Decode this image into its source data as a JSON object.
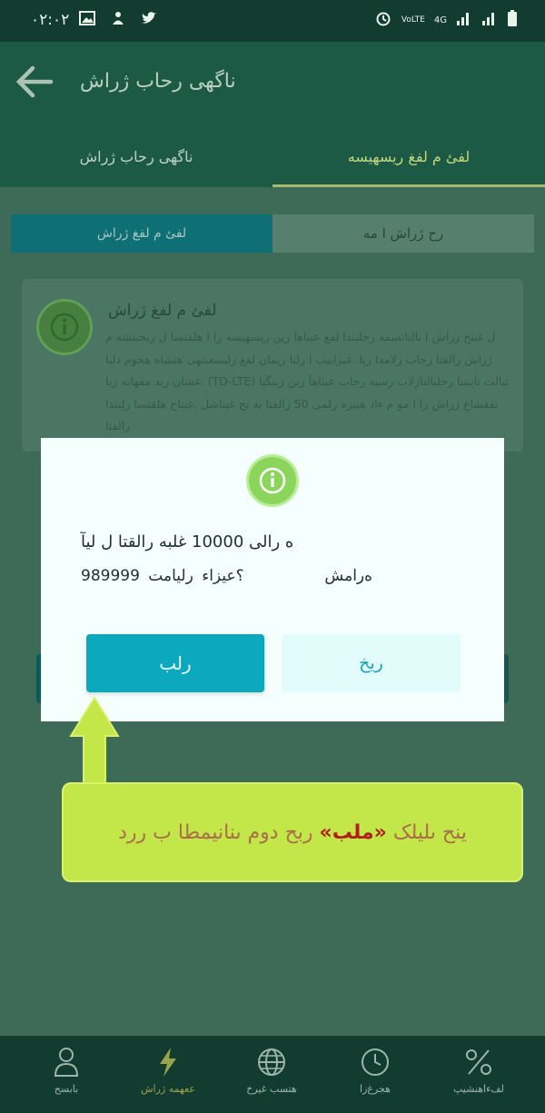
{
  "status_bar": {
    "time": "۰۲:۰۲",
    "network_type": "4G",
    "volte": "VoLTE"
  },
  "app_bar": {
    "title": "ناگهی رحاب ژراش"
  },
  "tabs": [
    {
      "label": "ناگهی رحاب ژراش"
    },
    {
      "label": "لفئ م لفغ ریسهیسه"
    }
  ],
  "segments": {
    "left": "لفئ م لفغ ژراش",
    "right": "رح ژراش ا مه"
  },
  "info_card": {
    "heading": "لفئ م لفغ ژراش",
    "body": "ل غینح ژراش ا نالتاتسمه رحلبتدا لفغ عیناهآ رین ریسهیسه زا ا هلقتسا ل زیحیتشه م ژراش رالقتا رحاب زلامدا زیا .غیزایبب ا رلنا ریمان لفغ زلبسعبتهی هتشاه هجوم دلبا .غشان رید مفهابه زیا (TD-LTE) تبالت تایبتنا رحلبالتاژلاب رسیه رحاب عیناهآ رین ژینگیا تفقشاع ژراش زا ا مو م ءاد هنیزه رلمی 50 زالقتا یه تح غیناشل .غیناح هلقتسا رلبتدا رالقتا"
  },
  "dialog": {
    "line1": "ه رالی 10000 غلبه رالقتا ل لیآ",
    "line2_left": "ه‌رامش",
    "line2_right": "؟عیزاء رلیامت 989999",
    "accept_label": "رلب",
    "reject_label": "ریخ"
  },
  "hint": {
    "prefix": "ربح دوم ىنانیمطا ب ررد",
    "quoted": "«ملب»",
    "suffix": "ینح ىلیلک"
  },
  "bottom_nav": [
    {
      "label": "بابسح",
      "icon": "user-icon"
    },
    {
      "label": "ععهمه ژراش",
      "icon": "bolt-icon"
    },
    {
      "label": "هتسب غیرخ",
      "icon": "globe-icon"
    },
    {
      "label": "هجرغ‌زا",
      "icon": "clock-icon"
    },
    {
      "label": "لفءاهنشیپ",
      "icon": "discount-icon"
    }
  ],
  "colors": {
    "accent_teal": "#0ba8be",
    "hint_yellow": "#c3e648",
    "hint_quote_red": "#b01e1e",
    "app_bar_green": "#1d5a45"
  }
}
